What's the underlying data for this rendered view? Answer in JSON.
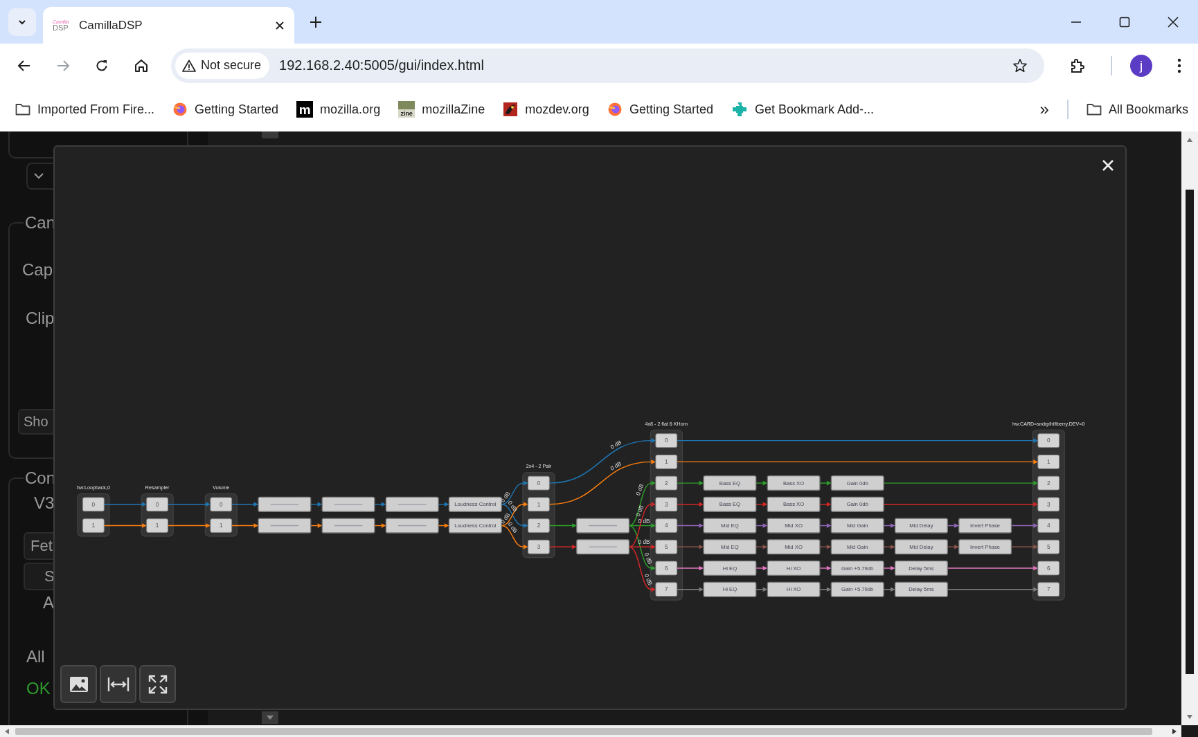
{
  "browser": {
    "tab": {
      "logo_top": "Camilla",
      "logo_bottom": "DSP",
      "title": "CamillaDSP"
    },
    "security": "Not secure",
    "url": "192.168.2.40:5005/gui/index.html",
    "profile": "j",
    "bookmarks": [
      {
        "kind": "folder",
        "label": "Imported From Fire..."
      },
      {
        "kind": "firefox",
        "label": "Getting Started"
      },
      {
        "kind": "mozilla",
        "logo_text": "m",
        "label": "mozilla.org"
      },
      {
        "kind": "zine",
        "logo_text": "zine",
        "label": "mozillaZine"
      },
      {
        "kind": "mozdev",
        "label": "mozdev.org"
      },
      {
        "kind": "firefox",
        "label": "Getting Started"
      },
      {
        "kind": "puzzle",
        "label": "Get Bookmark Add-..."
      }
    ],
    "overflow": "»",
    "all_bookmarks": "All Bookmarks"
  },
  "background": {
    "panels": [
      {
        "legend": "Can",
        "items": [
          {
            "kind": "label",
            "text": "Cap"
          },
          {
            "kind": "label",
            "text": "Clip"
          },
          {
            "kind": "button",
            "text": "Sho"
          }
        ]
      },
      {
        "legend": "Con",
        "items": [
          {
            "kind": "label",
            "text": "V3"
          },
          {
            "kind": "button",
            "text": "Fet"
          },
          {
            "kind": "button",
            "text": "S"
          },
          {
            "kind": "label",
            "text": "A"
          },
          {
            "kind": "label",
            "text": "All"
          },
          {
            "kind": "status",
            "text": "OK"
          }
        ]
      }
    ]
  },
  "graph": {
    "channels": [
      {
        "color": "#1f77b4"
      },
      {
        "color": "#ff7f0e"
      },
      {
        "color": "#2ca02c"
      },
      {
        "color": "#d62728"
      },
      {
        "color": "#9467bd"
      },
      {
        "color": "#8c564b"
      },
      {
        "color": "#e377c2"
      },
      {
        "color": "#7f7f7f"
      }
    ],
    "inputs": [
      {
        "title": "hw:Loopback,0",
        "ports": [
          {
            "label": "0"
          },
          {
            "label": "1"
          }
        ]
      },
      {
        "title": "Resampler",
        "ports": [
          {
            "label": "0"
          },
          {
            "label": "1"
          }
        ]
      },
      {
        "title": "Volume",
        "ports": [
          {
            "label": "0",
            "filters": [
              {
                "kind": "illegible"
              },
              {
                "kind": "illegible"
              },
              {
                "kind": "illegible"
              },
              {
                "kind": "named",
                "label": "Loudness Control"
              }
            ]
          },
          {
            "label": "1",
            "filters": [
              {
                "kind": "illegible"
              },
              {
                "kind": "illegible"
              },
              {
                "kind": "illegible"
              },
              {
                "kind": "named",
                "label": "Loudness Control"
              }
            ]
          }
        ]
      }
    ],
    "mixer_1": {
      "title": "2x4 - 2 Pair",
      "ports": [
        {
          "label": "0"
        },
        {
          "label": "1"
        },
        {
          "label": "2",
          "filters": [
            {
              "kind": "illegible"
            }
          ]
        },
        {
          "label": "3",
          "filters": [
            {
              "kind": "illegible"
            }
          ]
        }
      ],
      "routes": [
        [
          {
            "on": true,
            "gain": "0 dB"
          },
          {
            "on": false
          },
          {
            "on": true,
            "gain": "0 dB"
          },
          {
            "on": false
          }
        ],
        [
          {
            "on": false
          },
          {
            "on": true,
            "gain": "0 dB"
          },
          {
            "on": false
          },
          {
            "on": true,
            "gain": "0 dB"
          }
        ]
      ]
    },
    "mixer_2": {
      "title": "4x8 - 2 flat 6 KHorn",
      "ports": [
        {
          "label": "0"
        },
        {
          "label": "1"
        },
        {
          "label": "2",
          "filters": [
            {
              "kind": "named",
              "label": "Bass EQ"
            },
            {
              "kind": "named",
              "label": "Bass XO"
            },
            {
              "kind": "named",
              "label": "Gain 0db"
            }
          ]
        },
        {
          "label": "3",
          "filters": [
            {
              "kind": "named",
              "label": "Bass EQ"
            },
            {
              "kind": "named",
              "label": "Bass XO"
            },
            {
              "kind": "named",
              "label": "Gain 0db"
            }
          ]
        },
        {
          "label": "4",
          "filters": [
            {
              "kind": "named",
              "label": "Mid EQ"
            },
            {
              "kind": "named",
              "label": "Mid XO"
            },
            {
              "kind": "named",
              "label": "Mid Gain"
            },
            {
              "kind": "named",
              "label": "Mid Delay"
            },
            {
              "kind": "named",
              "label": "Invert Phase"
            }
          ]
        },
        {
          "label": "5",
          "filters": [
            {
              "kind": "named",
              "label": "Mid EQ"
            },
            {
              "kind": "named",
              "label": "Mid XO"
            },
            {
              "kind": "named",
              "label": "Mid Gain"
            },
            {
              "kind": "named",
              "label": "Mid Delay"
            },
            {
              "kind": "named",
              "label": "Invert Phase"
            }
          ]
        },
        {
          "label": "6",
          "filters": [
            {
              "kind": "named",
              "label": "Hi EQ"
            },
            {
              "kind": "named",
              "label": "Hi XO"
            },
            {
              "kind": "named",
              "label": "Gain +5.79db"
            },
            {
              "kind": "named",
              "label": "Delay 5ms"
            }
          ]
        },
        {
          "label": "7",
          "filters": [
            {
              "kind": "named",
              "label": "Hi EQ"
            },
            {
              "kind": "named",
              "label": "Hi XO"
            },
            {
              "kind": "named",
              "label": "Gain +5.79db"
            },
            {
              "kind": "named",
              "label": "Delay 5ms"
            }
          ]
        }
      ],
      "routes": [
        [
          {
            "on": true,
            "gain": "0 dB"
          },
          {
            "on": false
          },
          {
            "on": false
          },
          {
            "on": false
          },
          {
            "on": false
          },
          {
            "on": false
          },
          {
            "on": false
          },
          {
            "on": false
          }
        ],
        [
          {
            "on": false
          },
          {
            "on": true,
            "gain": "0 dB"
          },
          {
            "on": false
          },
          {
            "on": false
          },
          {
            "on": false
          },
          {
            "on": false
          },
          {
            "on": false
          },
          {
            "on": false
          }
        ],
        [
          {
            "on": false
          },
          {
            "on": false
          },
          {
            "on": true,
            "gain": "0 dB"
          },
          {
            "on": false
          },
          {
            "on": true,
            "gain": "0 dB"
          },
          {
            "on": false
          },
          {
            "on": true,
            "gain": "0 dB"
          },
          {
            "on": false
          }
        ],
        [
          {
            "on": false
          },
          {
            "on": false
          },
          {
            "on": false
          },
          {
            "on": true,
            "gain": "0 dB"
          },
          {
            "on": false
          },
          {
            "on": true,
            "gain": "0 dB"
          },
          {
            "on": false
          },
          {
            "on": true,
            "gain": "0 dB"
          }
        ]
      ]
    },
    "output": {
      "title": "hw:CARD=sndrpihifiberry,DEV=0",
      "ports": [
        {
          "label": "0"
        },
        {
          "label": "1"
        },
        {
          "label": "2"
        },
        {
          "label": "3"
        },
        {
          "label": "4"
        },
        {
          "label": "5"
        },
        {
          "label": "6"
        },
        {
          "label": "7"
        }
      ]
    }
  }
}
